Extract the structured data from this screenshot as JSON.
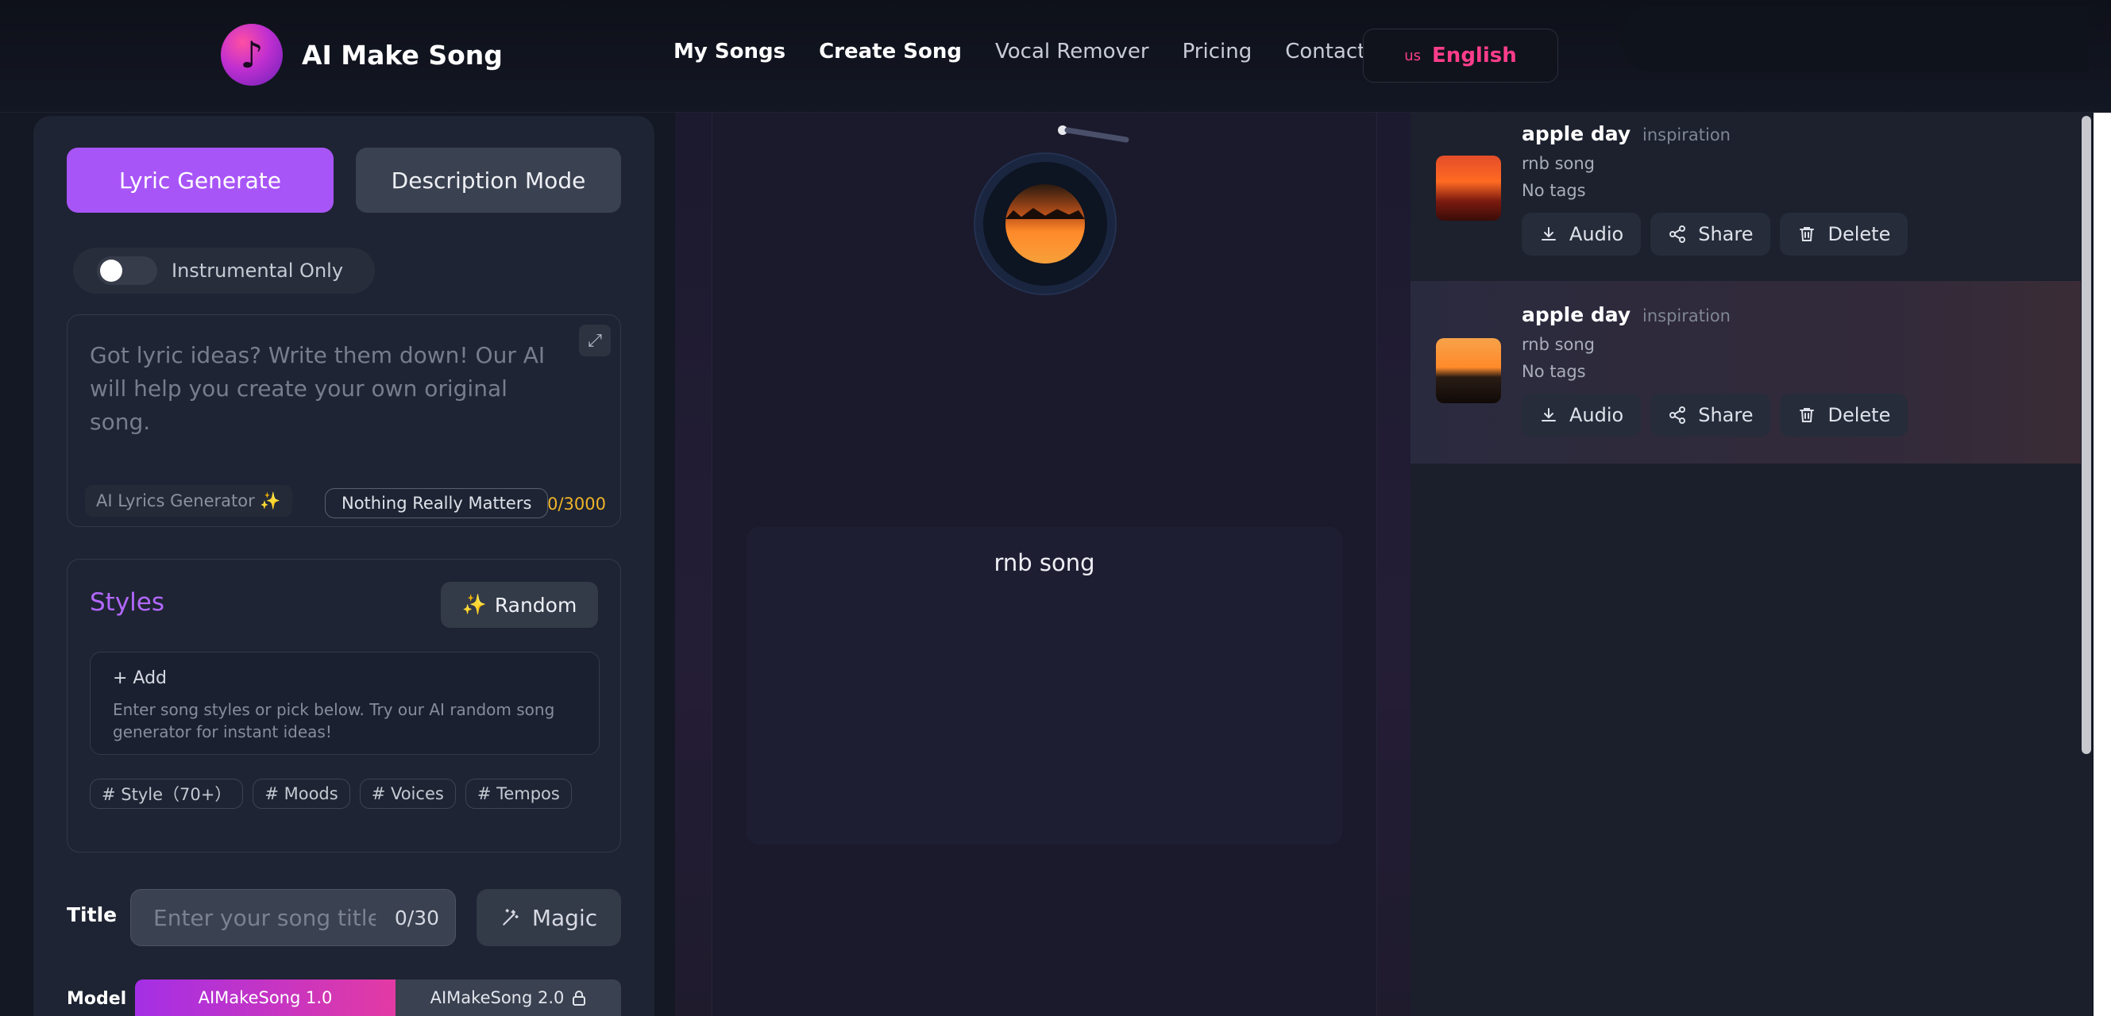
{
  "header": {
    "app_title": "AI Make Song",
    "nav": [
      "My Songs",
      "Create Song",
      "Vocal Remover",
      "Pricing",
      "Contact"
    ],
    "language_flag": "us",
    "language": "English"
  },
  "left": {
    "mode_primary": "Lyric Generate",
    "mode_secondary": "Description Mode",
    "instrumental_label": "Instrumental Only",
    "lyrics_placeholder": "Got lyric ideas? Write them down! Our AI will help you create your own original song.",
    "ai_chip": "AI Lyrics Generator ✨",
    "song_chip": "Nothing Really Matters",
    "char_count": "0/3000",
    "styles_title": "Styles",
    "random_label": "Random",
    "random_icon": "✨",
    "add_label": "+ Add",
    "styles_hint": "Enter song styles or pick below. Try our AI random song generator for instant ideas!",
    "tags": [
      "# Style（70+）",
      "# Moods",
      "# Voices",
      "# Tempos"
    ],
    "title_label": "Title",
    "title_placeholder": "Enter your song title",
    "title_count": "0/30",
    "magic_label": "Magic",
    "model_label": "Model",
    "model_options": [
      "AIMakeSong 1.0",
      "AIMakeSong 2.0"
    ]
  },
  "middle": {
    "song_caption": "rnb song"
  },
  "songs": [
    {
      "title": "apple day",
      "tag": "inspiration",
      "style": "rnb song",
      "tags_text": "No tags"
    },
    {
      "title": "apple day",
      "tag": "inspiration",
      "style": "rnb song",
      "tags_text": "No tags"
    }
  ],
  "actions": {
    "audio": "Audio",
    "share": "Share",
    "delete": "Delete"
  },
  "colors": {
    "accent": "#a855f7",
    "language": "#ff3d8b",
    "count": "#f0b429"
  }
}
